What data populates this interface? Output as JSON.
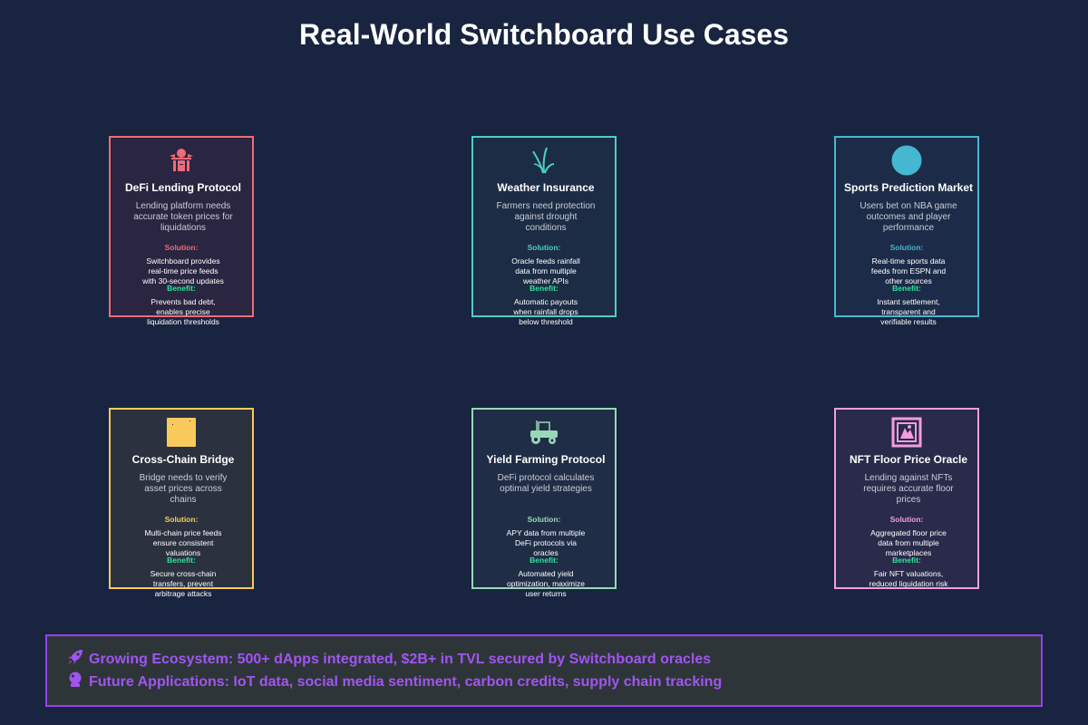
{
  "title": "Real-World Switchboard Use Cases",
  "cards": [
    {
      "title": "DeFi Lending Protocol",
      "problem": "Lending platform needs accurate token prices for liquidations",
      "solution_label": "Solution:",
      "solution": "Switchboard provides real-time price feeds with 30-second updates",
      "benefit_label": "Benefit:",
      "benefit": "Prevents bad debt, enables precise liquidation thresholds",
      "color": "#f06b77",
      "icon": "bank-icon"
    },
    {
      "title": "Weather Insurance",
      "problem": "Farmers need protection against drought conditions",
      "solution_label": "Solution:",
      "solution": "Oracle feeds rainfall data from multiple weather APIs",
      "benefit_label": "Benefit:",
      "benefit": "Automatic payouts when rainfall drops below threshold",
      "color": "#4ecdc4",
      "icon": "seedling-icon"
    },
    {
      "title": "Sports Prediction Market",
      "problem": "Users bet on NBA game outcomes and player performance",
      "solution_label": "Solution:",
      "solution": "Real-time sports data feeds from ESPN and other sources",
      "benefit_label": "Benefit:",
      "benefit": "Instant settlement, transparent and verifiable results",
      "color": "#45b7d1",
      "icon": "basketball-icon"
    },
    {
      "title": "Cross-Chain Bridge",
      "problem": "Bridge needs to verify asset prices across chains",
      "solution_label": "Solution:",
      "solution": "Multi-chain price feeds ensure consistent valuations",
      "benefit_label": "Benefit:",
      "benefit": "Secure cross-chain transfers, prevent arbitrage attacks",
      "color": "#f9ca5b",
      "icon": "bridge-icon"
    },
    {
      "title": "Yield Farming Protocol",
      "problem": "DeFi protocol calculates optimal yield strategies",
      "solution_label": "Solution:",
      "solution": "APY data from multiple DeFi protocols via oracles",
      "benefit_label": "Benefit:",
      "benefit": "Automated yield optimization, maximize user returns",
      "color": "#98d8b8",
      "icon": "tractor-icon"
    },
    {
      "title": "NFT Floor Price Oracle",
      "problem": "Lending against NFTs requires accurate floor prices",
      "solution_label": "Solution:",
      "solution": "Aggregated floor price data from multiple marketplaces",
      "benefit_label": "Benefit:",
      "benefit": "Fair NFT valuations, reduced liquidation risk",
      "color": "#f39de0",
      "icon": "frame-picture-icon"
    }
  ],
  "footer": {
    "line1": "Growing Ecosystem: 500+ dApps integrated, $2B+ in TVL secured by Switchboard oracles",
    "line2": "Future Applications: IoT data, social media sentiment, carbon credits, supply chain tracking",
    "line1_icon": "rocket-icon",
    "line2_icon": "crystal-ball-icon"
  }
}
